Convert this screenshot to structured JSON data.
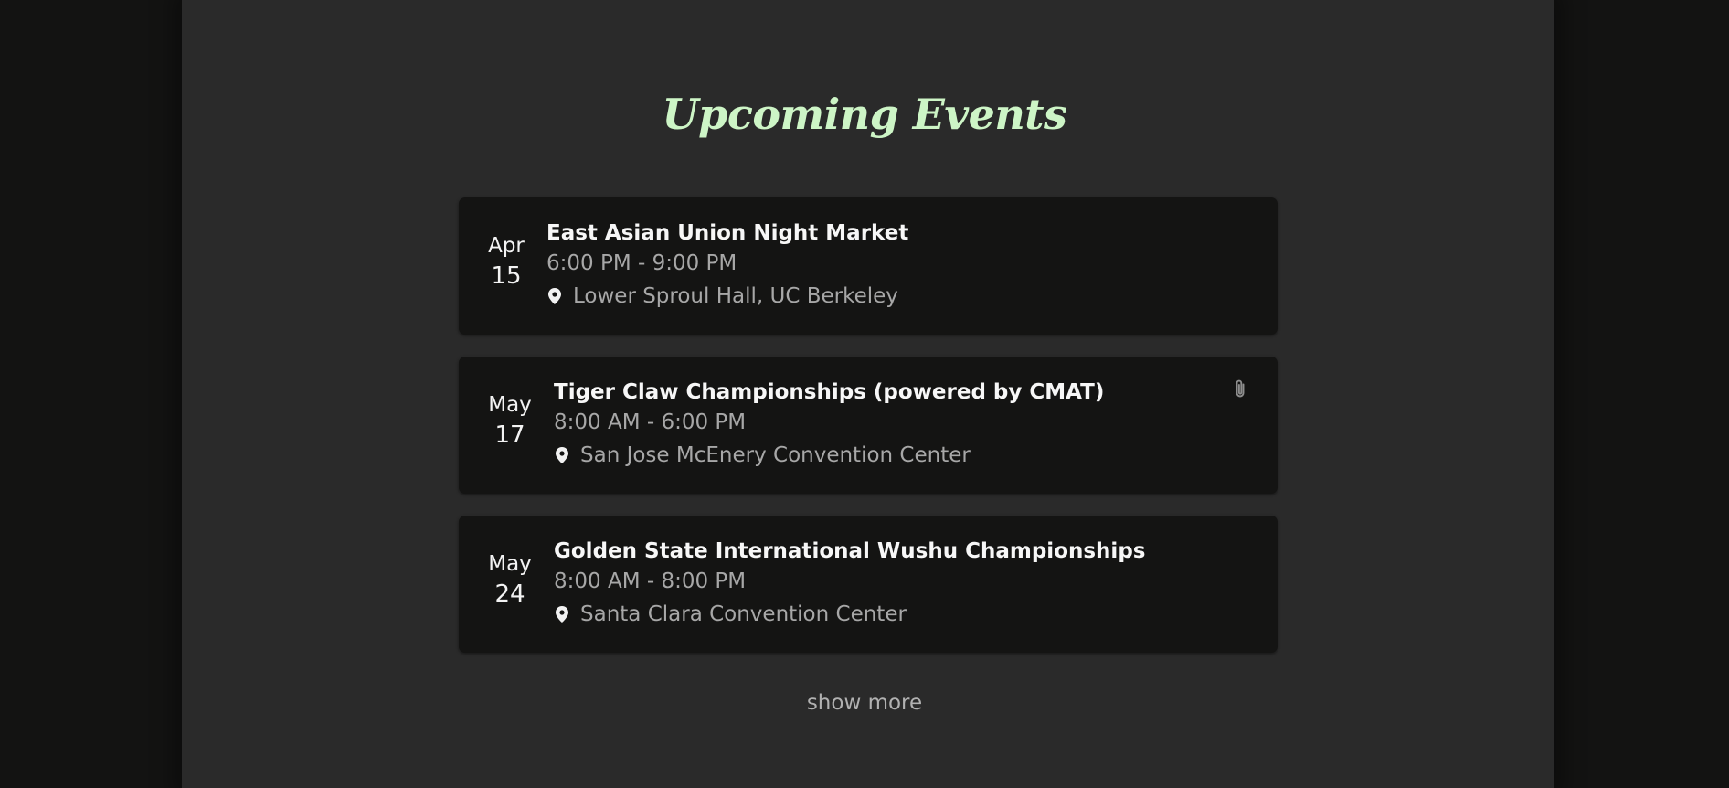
{
  "section": {
    "title": "Upcoming Events",
    "show_more_label": "show more"
  },
  "events": [
    {
      "month": "Apr",
      "day": "15",
      "name": "East Asian Union Night Market",
      "time": "6:00 PM - 9:00 PM",
      "location": "Lower Sproul Hall, UC Berkeley",
      "has_attachment": false
    },
    {
      "month": "May",
      "day": "17",
      "name": "Tiger Claw Championships (powered by CMAT)",
      "time": "8:00 AM - 6:00 PM",
      "location": "San Jose McEnery Convention Center",
      "has_attachment": true
    },
    {
      "month": "May",
      "day": "24",
      "name": "Golden State International Wushu Championships",
      "time": "8:00 AM - 8:00 PM",
      "location": "Santa Clara Convention Center",
      "has_attachment": false
    }
  ],
  "icons": {
    "location": "map-pin-icon",
    "attachment": "paperclip-icon"
  },
  "colors": {
    "title_accent": "#cdf5c6",
    "page_background": "#2a2a2a",
    "card_background": "#141413",
    "outer_background": "#131312"
  }
}
